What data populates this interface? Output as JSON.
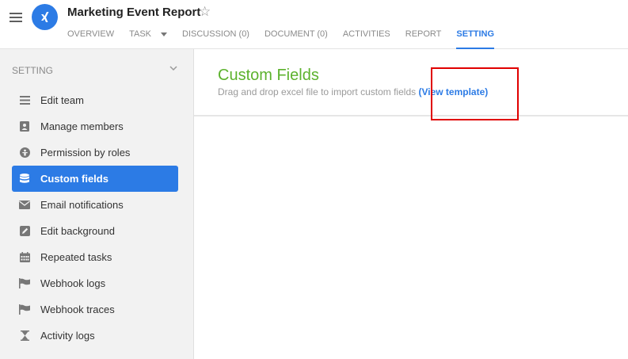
{
  "header": {
    "title": "Marketing Event Report",
    "tabs": [
      {
        "label": "OVERVIEW"
      },
      {
        "label": "TASK"
      },
      {
        "label": "DISCUSSION (0)"
      },
      {
        "label": "DOCUMENT (0)"
      },
      {
        "label": "ACTIVITIES"
      },
      {
        "label": "REPORT"
      },
      {
        "label": "SETTING"
      }
    ]
  },
  "sidebar": {
    "heading": "SETTING",
    "items": [
      {
        "label": "Edit team",
        "icon": "list-icon"
      },
      {
        "label": "Manage members",
        "icon": "contact-icon"
      },
      {
        "label": "Permission by roles",
        "icon": "person-circle-icon"
      },
      {
        "label": "Custom fields",
        "icon": "database-icon"
      },
      {
        "label": "Email notifications",
        "icon": "envelope-icon"
      },
      {
        "label": "Edit background",
        "icon": "pencil-icon"
      },
      {
        "label": "Repeated tasks",
        "icon": "calendar-icon"
      },
      {
        "label": "Webhook logs",
        "icon": "flag-icon"
      },
      {
        "label": "Webhook traces",
        "icon": "flag-icon"
      },
      {
        "label": "Activity logs",
        "icon": "hourglass-icon"
      }
    ]
  },
  "main": {
    "title": "Custom Fields",
    "description": "Drag and drop excel file to import custom fields",
    "link_label": "(View template)"
  },
  "colors": {
    "accent": "#2c7be5",
    "title_green": "#5cb22d",
    "highlight_red": "#e00000"
  }
}
